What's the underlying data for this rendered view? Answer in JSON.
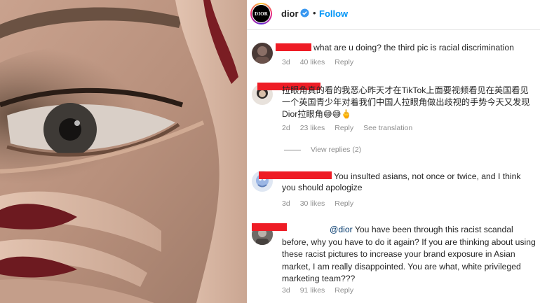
{
  "header": {
    "brand_name": "dior",
    "avatar_text": "DIOR",
    "separator": "•",
    "follow_label": "Follow"
  },
  "comments": [
    {
      "text": "what are u doing?  the third pic is racial discrimination",
      "age": "3d",
      "likes": "40 likes",
      "reply": "Reply"
    },
    {
      "text": "拉眼角真的看的我恶心昨天才在TikTok上面要视频看见在英国看见一个英国青少年对着我们中国人拉眼角做出歧视的手势今天又发现Dior拉眼角😅😅🖕",
      "age": "2d",
      "likes": "23 likes",
      "reply": "Reply",
      "translate": "See translation",
      "view_replies": "View replies (2)"
    },
    {
      "text": "You insulted asians, not once or twice, and I think you should apologize",
      "age": "3d",
      "likes": "30 likes",
      "reply": "Reply"
    },
    {
      "mention": "@dior",
      "text": " You have been through this racist scandal before, why you have to do it again? If you are thinking about using these racist pictures to increase your brand exposure in Asian market, I am really disappointed. You are what, white privileged marketing team???",
      "age": "3d",
      "likes": "91 likes",
      "reply": "Reply"
    }
  ],
  "colors": {
    "follow_blue": "#0095f6",
    "redaction_red": "#ee1c25",
    "meta_gray": "#8e8e8e"
  }
}
